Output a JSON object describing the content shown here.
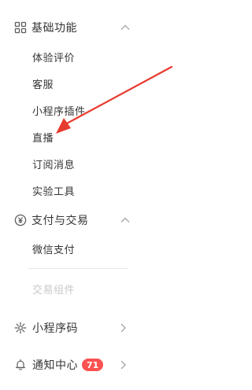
{
  "sections": [
    {
      "label": "基础功能",
      "icon": "grid-icon",
      "expanded": true,
      "items": [
        {
          "label": "体验评价"
        },
        {
          "label": "客服"
        },
        {
          "label": "小程序插件"
        },
        {
          "label": "直播"
        },
        {
          "label": "订阅消息"
        },
        {
          "label": "实验工具"
        }
      ]
    },
    {
      "label": "支付与交易",
      "icon": "yuan-icon",
      "expanded": true,
      "items": [
        {
          "label": "微信支付"
        },
        {
          "label": "交易组件",
          "disabled": true
        }
      ]
    }
  ],
  "bottom": [
    {
      "label": "小程序码",
      "icon": "code-icon"
    },
    {
      "label": "通知中心",
      "icon": "bell-icon",
      "badge": "71"
    }
  ],
  "colors": {
    "text": "#353535",
    "disabled_text": "#c9c9c9",
    "badge_bg": "#fa5151",
    "annotation_arrow": "#e83a2f",
    "icon": "#5c5c5c",
    "chevron": "#a8a8a8"
  }
}
